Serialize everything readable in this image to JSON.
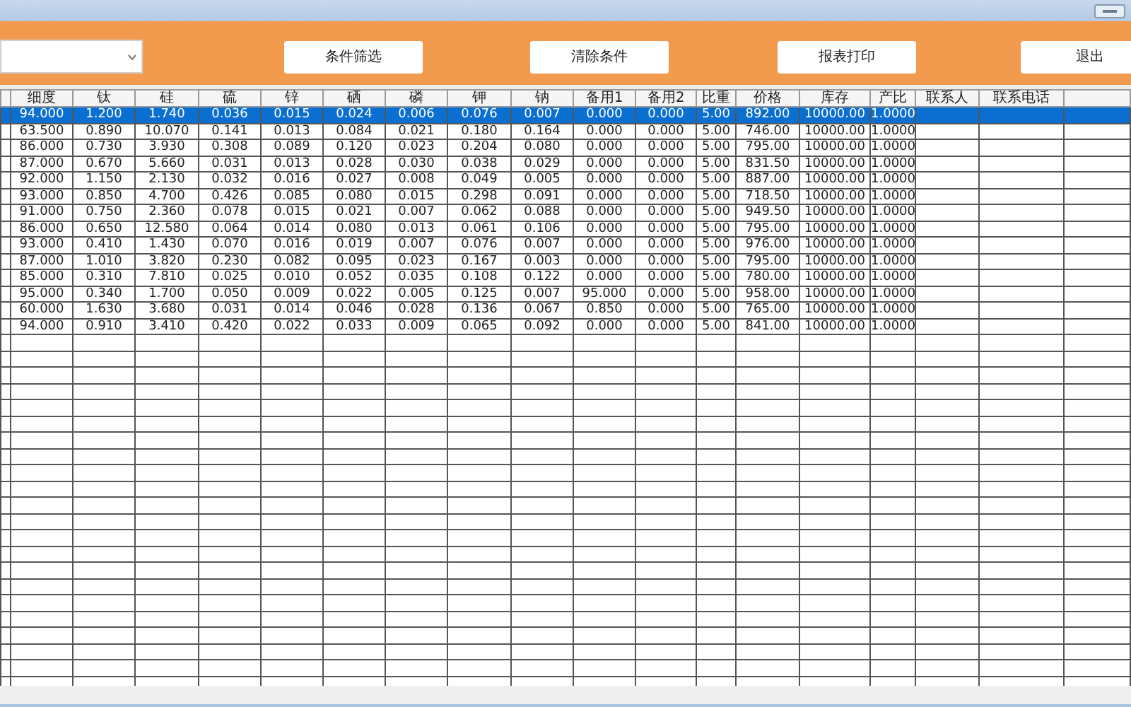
{
  "toolbar": {
    "dropdown": {
      "expanded": false
    },
    "buttons": [
      "条件筛选",
      "清除条件",
      "报表打印",
      "退出"
    ]
  },
  "table": {
    "columns": [
      "细度",
      "钛",
      "硅",
      "硫",
      "锌",
      "硒",
      "磷",
      "钾",
      "钠",
      "备用1",
      "备用2",
      "比重",
      "价格",
      "库存",
      "产比",
      "联系人",
      "联系电话"
    ],
    "rows": [
      {
        "selected": true,
        "cells": [
          "94.000",
          "1.200",
          "1.740",
          "0.036",
          "0.015",
          "0.024",
          "0.006",
          "0.076",
          "0.007",
          "0.000",
          "0.000",
          "5.00",
          "892.00",
          "10000.00",
          "1.0000"
        ]
      },
      {
        "selected": false,
        "cells": [
          "63.500",
          "0.890",
          "10.070",
          "0.141",
          "0.013",
          "0.084",
          "0.021",
          "0.180",
          "0.164",
          "0.000",
          "0.000",
          "5.00",
          "746.00",
          "10000.00",
          "1.0000"
        ]
      },
      {
        "selected": false,
        "cells": [
          "86.000",
          "0.730",
          "3.930",
          "0.308",
          "0.089",
          "0.120",
          "0.023",
          "0.204",
          "0.080",
          "0.000",
          "0.000",
          "5.00",
          "795.00",
          "10000.00",
          "1.0000"
        ]
      },
      {
        "selected": false,
        "cells": [
          "87.000",
          "0.670",
          "5.660",
          "0.031",
          "0.013",
          "0.028",
          "0.030",
          "0.038",
          "0.029",
          "0.000",
          "0.000",
          "5.00",
          "831.50",
          "10000.00",
          "1.0000"
        ]
      },
      {
        "selected": false,
        "cells": [
          "92.000",
          "1.150",
          "2.130",
          "0.032",
          "0.016",
          "0.027",
          "0.008",
          "0.049",
          "0.005",
          "0.000",
          "0.000",
          "5.00",
          "887.00",
          "10000.00",
          "1.0000"
        ]
      },
      {
        "selected": false,
        "cells": [
          "93.000",
          "0.850",
          "4.700",
          "0.426",
          "0.085",
          "0.080",
          "0.015",
          "0.298",
          "0.091",
          "0.000",
          "0.000",
          "5.00",
          "718.50",
          "10000.00",
          "1.0000"
        ]
      },
      {
        "selected": false,
        "cells": [
          "91.000",
          "0.750",
          "2.360",
          "0.078",
          "0.015",
          "0.021",
          "0.007",
          "0.062",
          "0.088",
          "0.000",
          "0.000",
          "5.00",
          "949.50",
          "10000.00",
          "1.0000"
        ]
      },
      {
        "selected": false,
        "cells": [
          "86.000",
          "0.650",
          "12.580",
          "0.064",
          "0.014",
          "0.080",
          "0.013",
          "0.061",
          "0.106",
          "0.000",
          "0.000",
          "5.00",
          "795.00",
          "10000.00",
          "1.0000"
        ]
      },
      {
        "selected": false,
        "cells": [
          "93.000",
          "0.410",
          "1.430",
          "0.070",
          "0.016",
          "0.019",
          "0.007",
          "0.076",
          "0.007",
          "0.000",
          "0.000",
          "5.00",
          "976.00",
          "10000.00",
          "1.0000"
        ]
      },
      {
        "selected": false,
        "cells": [
          "87.000",
          "1.010",
          "3.820",
          "0.230",
          "0.082",
          "0.095",
          "0.023",
          "0.167",
          "0.003",
          "0.000",
          "0.000",
          "5.00",
          "795.00",
          "10000.00",
          "1.0000"
        ]
      },
      {
        "selected": false,
        "cells": [
          "85.000",
          "0.310",
          "7.810",
          "0.025",
          "0.010",
          "0.052",
          "0.035",
          "0.108",
          "0.122",
          "0.000",
          "0.000",
          "5.00",
          "780.00",
          "10000.00",
          "1.0000"
        ]
      },
      {
        "selected": false,
        "cells": [
          "95.000",
          "0.340",
          "1.700",
          "0.050",
          "0.009",
          "0.022",
          "0.005",
          "0.125",
          "0.007",
          "95.000",
          "0.000",
          "5.00",
          "958.00",
          "10000.00",
          "1.0000"
        ]
      },
      {
        "selected": false,
        "cells": [
          "60.000",
          "1.630",
          "3.680",
          "0.031",
          "0.014",
          "0.046",
          "0.028",
          "0.136",
          "0.067",
          "0.850",
          "0.000",
          "5.00",
          "765.00",
          "10000.00",
          "1.0000"
        ]
      },
      {
        "selected": false,
        "cells": [
          "94.000",
          "0.910",
          "3.410",
          "0.420",
          "0.022",
          "0.033",
          "0.009",
          "0.065",
          "0.092",
          "0.000",
          "0.000",
          "5.00",
          "841.00",
          "10000.00",
          "1.0000"
        ]
      }
    ]
  }
}
